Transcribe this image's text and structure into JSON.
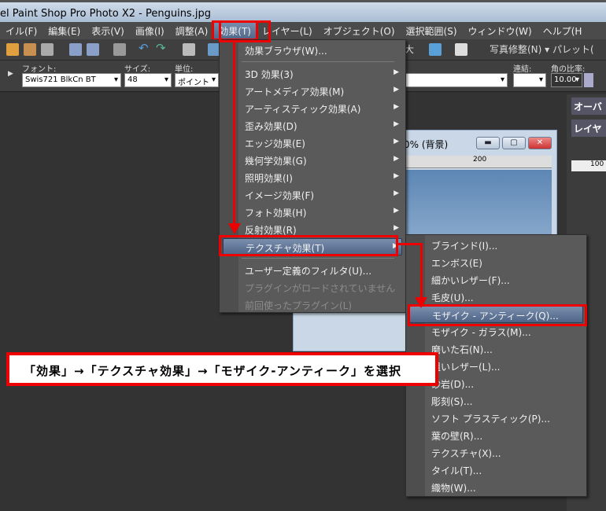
{
  "window": {
    "title": "el Paint Shop Pro Photo X2 - Penguins.jpg"
  },
  "menubar": [
    "イル(F)",
    "編集(E)",
    "表示(V)",
    "画像(I)",
    "調整(A)",
    "効果(T)",
    "レイヤー(L)",
    "オブジェクト(O)",
    "選択範囲(S)",
    "ウィンドウ(W)",
    "ヘルプ(H"
  ],
  "menubar_active": "効果(T)",
  "toolbar": {
    "zoom_partial": "大",
    "photo_fix": "写真修整(N) ▾",
    "palette": "パレット("
  },
  "options": {
    "font_label": "フォント:",
    "font_value": "Swis721 BlkCn BT",
    "size_label": "サイズ:",
    "size_value": "48",
    "unit_label": "単位:",
    "unit_value": "ポイント",
    "join_label": "連結:",
    "ratio_label": "角の比率:",
    "ratio_value": "10.00"
  },
  "image_window": {
    "title": "0% (背景)",
    "ruler_mark": "200"
  },
  "right_panel": {
    "overview": "オーバ",
    "layers": "レイヤ",
    "opacity": "100"
  },
  "effects_menu": [
    {
      "label": "効果ブラウザ(W)...",
      "submenu": false
    },
    {
      "separator": true
    },
    {
      "label": "3D 効果(3)",
      "submenu": true
    },
    {
      "label": "アートメディア効果(M)",
      "submenu": true
    },
    {
      "label": "アーティスティック効果(A)",
      "submenu": true
    },
    {
      "label": "歪み効果(D)",
      "submenu": true
    },
    {
      "label": "エッジ効果(E)",
      "submenu": true
    },
    {
      "label": "幾何学効果(G)",
      "submenu": true
    },
    {
      "label": "照明効果(I)",
      "submenu": true
    },
    {
      "label": "イメージ効果(F)",
      "submenu": true
    },
    {
      "label": "フォト効果(H)",
      "submenu": true
    },
    {
      "label": "反射効果(R)",
      "submenu": true
    },
    {
      "label": "テクスチャ効果(T)",
      "submenu": true,
      "highlighted": true
    },
    {
      "separator": true
    },
    {
      "label": "ユーザー定義のフィルタ(U)...",
      "submenu": false
    },
    {
      "label": "プラグインがロードされていません",
      "disabled": true
    },
    {
      "label": "前回使ったプラグイン(L)",
      "disabled": true
    }
  ],
  "texture_submenu": [
    {
      "label": "ブラインド(I)..."
    },
    {
      "label": "エンボス(E)"
    },
    {
      "label": "細かいレザー(F)..."
    },
    {
      "label": "毛皮(U)..."
    },
    {
      "label": "モザイク - アンティーク(Q)...",
      "highlighted": true
    },
    {
      "label": "モザイク - ガラス(M)..."
    },
    {
      "label": "磨いた石(N)..."
    },
    {
      "label": "粗いレザー(L)..."
    },
    {
      "label": "砂岩(D)..."
    },
    {
      "label": "彫刻(S)..."
    },
    {
      "label": "ソフト プラスティック(P)..."
    },
    {
      "label": "葉の壁(R)..."
    },
    {
      "label": "テクスチャ(X)..."
    },
    {
      "label": "タイル(T)..."
    },
    {
      "label": "織物(W)..."
    }
  ],
  "callout": "「効果」→「テクスチャ効果」→「モザイク-アンティーク」を選択",
  "colors": {
    "annotation_red": "#e00000",
    "menu_bg": "#5a5a5a",
    "highlight": "#6a7f9f"
  }
}
